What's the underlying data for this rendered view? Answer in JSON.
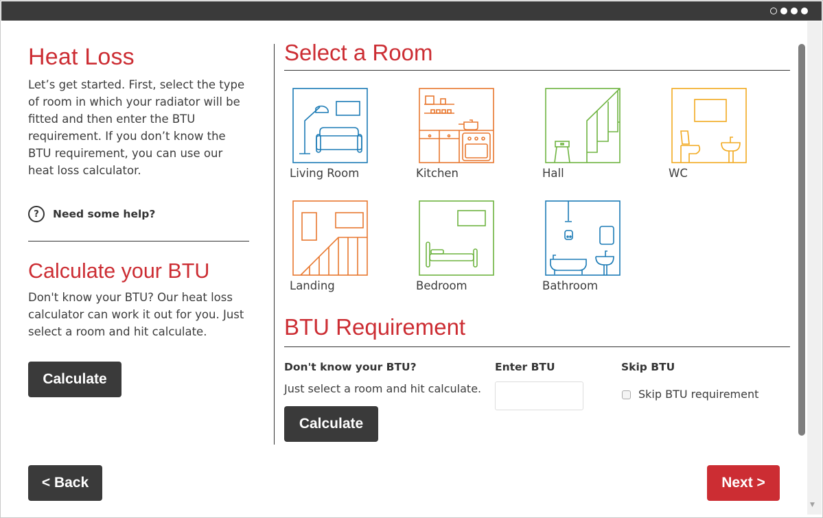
{
  "progress": {
    "total_steps": 4,
    "current_step": 1
  },
  "left": {
    "title": "Heat Loss",
    "intro": "Let’s get started. First, select the type of room in which your radiator will be fitted and then enter the BTU requirement. If you don’t know the BTU requirement, you can use our heat loss calculator.",
    "help_label": "Need some help?",
    "help_icon": "question-circle-icon",
    "calc_title": "Calculate your BTU",
    "calc_text": "Don't know your BTU? Our heat loss calculator can work it out for you. Just select a room and hit calculate.",
    "calc_button": "Calculate"
  },
  "rooms_section": {
    "title": "Select a Room",
    "rooms": [
      {
        "label": "Living Room",
        "icon": "living-room-icon",
        "color": "#1a7ab5"
      },
      {
        "label": "Kitchen",
        "icon": "kitchen-icon",
        "color": "#e8772e"
      },
      {
        "label": "Hall",
        "icon": "hall-icon",
        "color": "#6db33f"
      },
      {
        "label": "WC",
        "icon": "wc-icon",
        "color": "#f2a91e"
      },
      {
        "label": "Landing",
        "icon": "landing-icon",
        "color": "#e8772e"
      },
      {
        "label": "Bedroom",
        "icon": "bedroom-icon",
        "color": "#6db33f"
      },
      {
        "label": "Bathroom",
        "icon": "bathroom-icon",
        "color": "#1a7ab5"
      }
    ]
  },
  "btu_section": {
    "title": "BTU Requirement",
    "dont_know_label": "Don't know your BTU?",
    "dont_know_text": "Just select a room and hit calculate.",
    "calc_button": "Calculate",
    "enter_label": "Enter BTU",
    "enter_value": "",
    "skip_label": "Skip BTU",
    "skip_checkbox_label": "Skip BTU requirement",
    "skip_checked": false
  },
  "nav": {
    "back": "< Back",
    "next": "Next >"
  },
  "colors": {
    "accent_red": "#cc2d33",
    "dark": "#3a3a3a"
  }
}
